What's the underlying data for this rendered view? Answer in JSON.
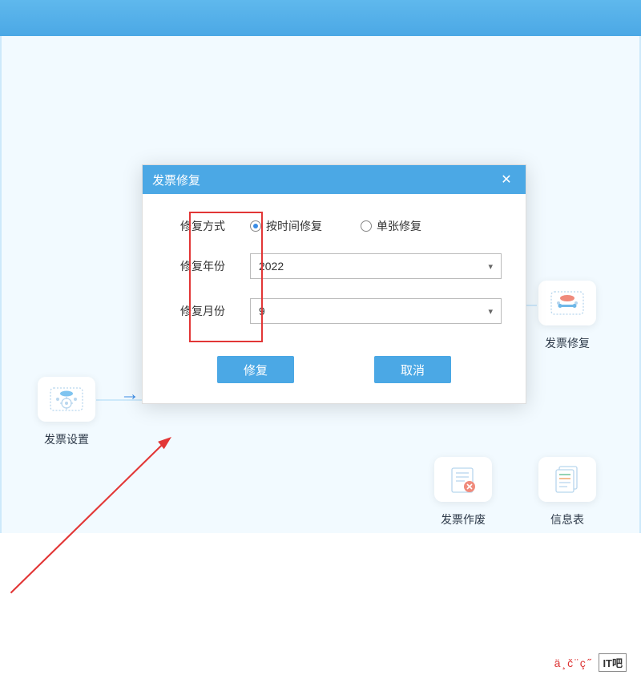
{
  "dialog": {
    "title": "发票修复",
    "fields": {
      "method_label": "修复方式",
      "method_option1": "按时间修复",
      "method_option2": "单张修复",
      "year_label": "修复年份",
      "year_value": "2022",
      "month_label": "修复月份",
      "month_value": "9"
    },
    "buttons": {
      "repair": "修复",
      "cancel": "取消"
    }
  },
  "icons": {
    "settings": "发票设置",
    "repair": "发票修复",
    "void": "发票作废",
    "info": "信息表"
  },
  "watermark": {
    "text": "ä¸č¨ç˝",
    "logo": "IT吧"
  }
}
